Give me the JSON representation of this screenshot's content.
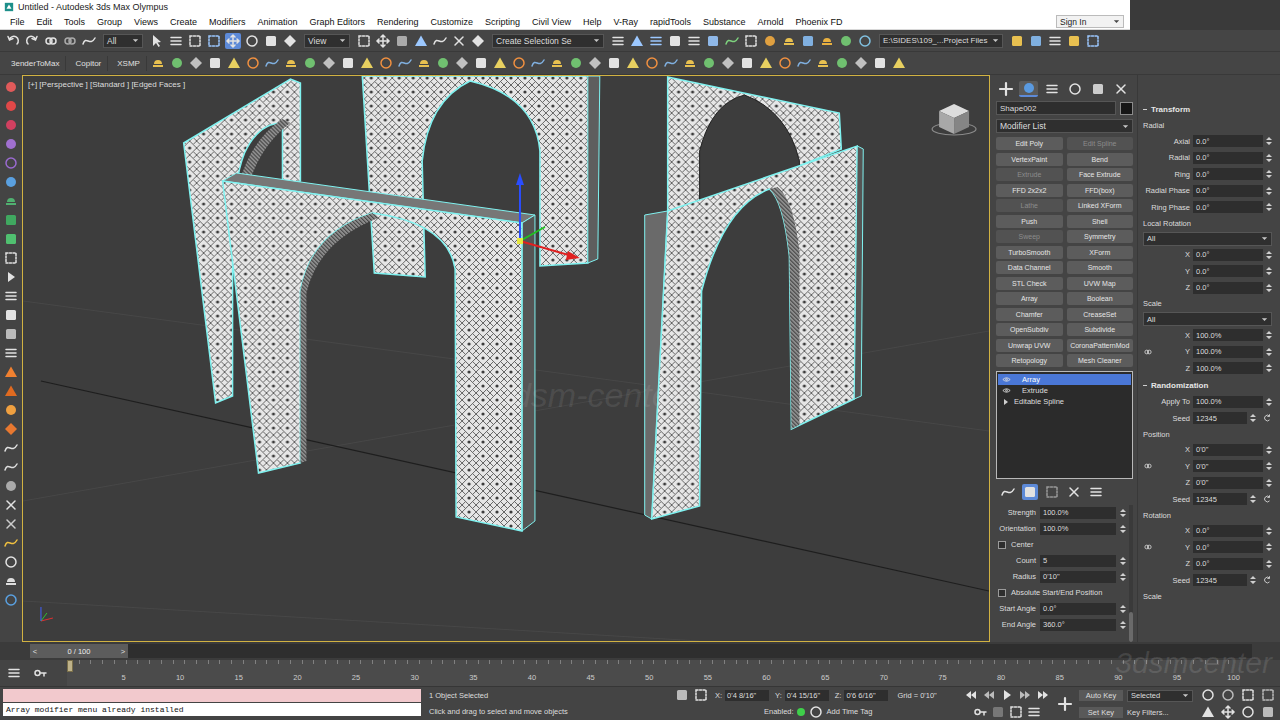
{
  "window": {
    "title": "Untitled - Autodesk 3ds Max Olympus"
  },
  "menu": [
    "File",
    "Edit",
    "Tools",
    "Group",
    "Views",
    "Create",
    "Modifiers",
    "Animation",
    "Graph Editors",
    "Rendering",
    "Customize",
    "Scripting",
    "Civil View",
    "Help",
    "V-Ray",
    "rapidTools",
    "Substance",
    "Arnold",
    "Phoenix FD"
  ],
  "sign_in": "Sign In",
  "toolbar": {
    "selection_filter": "All",
    "reference_coordinate": "View",
    "selection_set": "Create Selection Se",
    "project_path": "E:\\SIDES\\109_...Project Files",
    "move_tool_active": true
  },
  "toolbar2": {
    "buttons": [
      "3enderToMax",
      "Copitor",
      "XSMP"
    ]
  },
  "viewport": {
    "label": "[+] [Perspective ] [Standard ] [Edged Faces ]",
    "active": true,
    "watermark": "3dsm-center"
  },
  "command_panel": {
    "tabs": [
      {
        "selected": false
      },
      {
        "selected": true
      },
      {
        "selected": false
      },
      {
        "selected": false
      },
      {
        "selected": false
      },
      {
        "selected": false
      }
    ],
    "object_name": "Shape002",
    "modifier_list": "Modifier List",
    "buttons": [
      {
        "label": "Edit Poly",
        "disabled": false
      },
      {
        "label": "Edit Spline",
        "disabled": true
      },
      {
        "label": "VertexPaint",
        "disabled": false
      },
      {
        "label": "Bend",
        "disabled": false
      },
      {
        "label": "Extrude",
        "disabled": true
      },
      {
        "label": "Face Extrude",
        "disabled": false
      },
      {
        "label": "FFD 2x2x2",
        "disabled": false
      },
      {
        "label": "FFD(box)",
        "disabled": false
      },
      {
        "label": "Lathe",
        "disabled": true
      },
      {
        "label": "Linked XForm",
        "disabled": false
      },
      {
        "label": "Push",
        "disabled": false
      },
      {
        "label": "Shell",
        "disabled": false
      },
      {
        "label": "Sweep",
        "disabled": true
      },
      {
        "label": "Symmetry",
        "disabled": false
      },
      {
        "label": "TurboSmooth",
        "disabled": false
      },
      {
        "label": "XForm",
        "disabled": false
      },
      {
        "label": "Data Channel",
        "disabled": false
      },
      {
        "label": "Smooth",
        "disabled": false
      },
      {
        "label": "STL Check",
        "disabled": false
      },
      {
        "label": "UVW Map",
        "disabled": false
      },
      {
        "label": "Array",
        "disabled": false
      },
      {
        "label": "Boolean",
        "disabled": false
      },
      {
        "label": "Chamfer",
        "disabled": false
      },
      {
        "label": "CreaseSet",
        "disabled": false
      },
      {
        "label": "OpenSubdiv",
        "disabled": false
      },
      {
        "label": "Subdivide",
        "disabled": false
      },
      {
        "label": "Unwrap UVW",
        "disabled": false
      },
      {
        "label": "CoronaPatternMod",
        "disabled": false
      },
      {
        "label": "Retopology",
        "disabled": false
      },
      {
        "label": "Mesh Cleaner",
        "disabled": false
      }
    ],
    "stack": [
      {
        "label": "Array",
        "selected": true,
        "visible": true,
        "expandable": false
      },
      {
        "label": "Extrude",
        "selected": false,
        "visible": true,
        "expandable": false
      },
      {
        "label": "Editable Spline",
        "selected": false,
        "visible": false,
        "expandable": true
      }
    ],
    "show_end_result": true,
    "params": [
      {
        "kind": "spinner",
        "label": "Strength",
        "value": "100.0%"
      },
      {
        "kind": "spinner",
        "label": "Orientation",
        "value": "100.0%"
      },
      {
        "kind": "checkbox",
        "label": "Center",
        "checked": false
      },
      {
        "kind": "spinner",
        "label": "Count",
        "value": "5"
      },
      {
        "kind": "spinner",
        "label": "Radius",
        "value": "0'10\""
      },
      {
        "kind": "checkbox",
        "label": "Absolute Start/End Position",
        "checked": false
      },
      {
        "kind": "spinner",
        "label": "Start Angle",
        "value": "0.0°"
      },
      {
        "kind": "spinner",
        "label": "End Angle",
        "value": "360.0°"
      }
    ]
  },
  "array_panel": [
    {
      "kind": "rollout",
      "label": "Transform"
    },
    {
      "kind": "group",
      "label": "Radial"
    },
    {
      "kind": "field",
      "label": "Axial",
      "value": "0.0°",
      "link": false
    },
    {
      "kind": "field",
      "label": "Radial",
      "value": "0.0°",
      "link": false
    },
    {
      "kind": "field",
      "label": "Ring",
      "value": "0.0°",
      "link": false
    },
    {
      "kind": "field",
      "label": "Radial Phase",
      "value": "0.0°",
      "link": false
    },
    {
      "kind": "field",
      "label": "Ring Phase",
      "value": "0.0°",
      "link": false
    },
    {
      "kind": "group",
      "label": "Local Rotation"
    },
    {
      "kind": "dropdown",
      "value": "All"
    },
    {
      "kind": "field",
      "label": "X",
      "value": "0.0°",
      "link": false
    },
    {
      "kind": "field",
      "label": "Y",
      "value": "0.0°",
      "link": false
    },
    {
      "kind": "field",
      "label": "Z",
      "value": "0.0°",
      "link": false
    },
    {
      "kind": "group",
      "label": "Scale"
    },
    {
      "kind": "dropdown",
      "value": "All"
    },
    {
      "kind": "field",
      "label": "X",
      "value": "100.0%",
      "link": false
    },
    {
      "kind": "field",
      "label": "Y",
      "value": "100.0%",
      "link": true
    },
    {
      "kind": "field",
      "label": "Z",
      "value": "100.0%",
      "link": false
    },
    {
      "kind": "rollout",
      "label": "Randomization"
    },
    {
      "kind": "field",
      "label": "Apply To",
      "value": "100.0%",
      "link": false
    },
    {
      "kind": "seed",
      "label": "Seed",
      "value": "12345",
      "link": false
    },
    {
      "kind": "group",
      "label": "Position"
    },
    {
      "kind": "field",
      "label": "X",
      "value": "0'0\"",
      "link": false
    },
    {
      "kind": "field",
      "label": "Y",
      "value": "0'0\"",
      "link": true
    },
    {
      "kind": "field",
      "label": "Z",
      "value": "0'0\"",
      "link": false
    },
    {
      "kind": "seed",
      "label": "Seed",
      "value": "12345",
      "link": false
    },
    {
      "kind": "group",
      "label": "Rotation"
    },
    {
      "kind": "field",
      "label": "X",
      "value": "0.0°",
      "link": false
    },
    {
      "kind": "field",
      "label": "Y",
      "value": "0.0°",
      "link": true
    },
    {
      "kind": "field",
      "label": "Z",
      "value": "0.0°",
      "link": false
    },
    {
      "kind": "seed",
      "label": "Seed",
      "value": "12345",
      "link": false
    },
    {
      "kind": "group",
      "label": "Scale"
    }
  ],
  "timeline": {
    "prev": "<",
    "position": "0 / 100",
    "next": ">",
    "level": 0,
    "ticks": [
      "5",
      "10",
      "15",
      "20",
      "25",
      "30",
      "35",
      "40",
      "45",
      "50",
      "55",
      "60",
      "65",
      "70",
      "75",
      "80",
      "85",
      "90",
      "95",
      "100"
    ]
  },
  "status": {
    "listener_output": "Array modifier menu already installed",
    "selection": "1 Object Selected",
    "prompt": "Click and drag to select and move objects",
    "coords": [
      {
        "label": "X:",
        "value": "0'4 8/16\""
      },
      {
        "label": "Y:",
        "value": "0'4 15/16\""
      },
      {
        "label": "Z:",
        "value": "0'6 6/16\""
      }
    ],
    "grid": "Grid = 0'10\"",
    "enabled_label": "Enabled:",
    "enabled": true,
    "time_tag": "Add Time Tag",
    "auto_key": "Auto Key",
    "key_mode": "Selected",
    "set_key": "Set Key",
    "key_filters": "Key Filters..."
  },
  "corner_watermark": "3dsmcenter"
}
